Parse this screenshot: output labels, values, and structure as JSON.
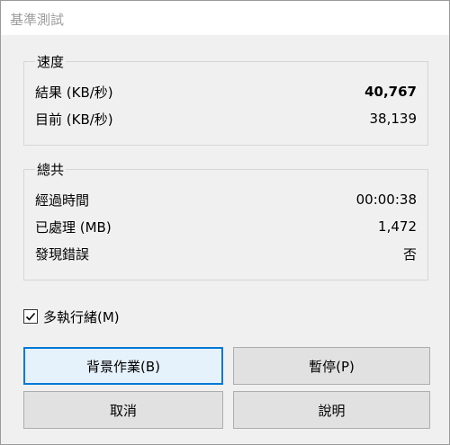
{
  "window": {
    "title": "基準測試"
  },
  "speed": {
    "legend": "速度",
    "rows": [
      {
        "label": "結果 (KB/秒)",
        "value": "40,767"
      },
      {
        "label": "目前 (KB/秒)",
        "value": "38,139"
      }
    ]
  },
  "total": {
    "legend": "總共",
    "rows": [
      {
        "label": "經過時間",
        "value": "00:00:38"
      },
      {
        "label": "已處理 (MB)",
        "value": "1,472"
      },
      {
        "label": "發現錯誤",
        "value": "否"
      }
    ]
  },
  "multithread": {
    "label": "多執行緒(M)",
    "checked": true
  },
  "buttons": {
    "background": "背景作業(B)",
    "pause": "暫停(P)",
    "cancel": "取消",
    "help": "說明"
  },
  "colors": {
    "accent": "#0078d7",
    "title_text": "#9c9c9c"
  }
}
